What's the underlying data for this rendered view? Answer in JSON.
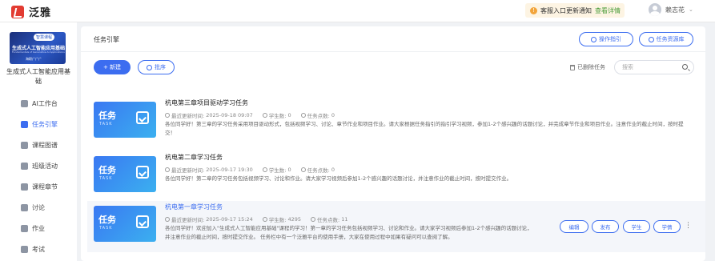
{
  "header": {
    "brand": "泛雅",
    "notice_text": "客服入口更新通知",
    "notice_link": "查看详情",
    "notice_icon": "info-icon",
    "user_name": "赖志花"
  },
  "sidebar": {
    "cover": {
      "badge": "智慧课程",
      "title": "生成式人工智能应用基础",
      "subtitle": "Fundamentals of Generative AI Applications",
      "foot": "海职广广广"
    },
    "course_name": "生成式人工智能应用基础",
    "items": [
      {
        "label": "AI工作台",
        "icon": "ai-icon"
      },
      {
        "label": "任务引擎",
        "icon": "task-icon",
        "active": true
      },
      {
        "label": "课程图谱",
        "icon": "graph-icon"
      },
      {
        "label": "班级活动",
        "icon": "activity-icon"
      },
      {
        "label": "课程章节",
        "icon": "chapter-icon"
      },
      {
        "label": "讨论",
        "icon": "discussion-icon"
      },
      {
        "label": "作业",
        "icon": "homework-icon"
      },
      {
        "label": "考试",
        "icon": "exam-icon"
      }
    ]
  },
  "main": {
    "title": "任务引擎",
    "guide_button": "操作指引",
    "library_button": "任务资源库",
    "new_button": "+ 新建",
    "batch_button": "批序",
    "deleted_label": "已删除任务",
    "search_placeholder": "搜索",
    "meta_labels": {
      "updated": "最近更新时间:",
      "students": "学生数:",
      "points": "任务点数:"
    },
    "tasks": [
      {
        "thumb_title": "任务",
        "thumb_sub": "TASK",
        "title": "杭电第三章项目驱动学习任务",
        "updated": "2025-09-18 09:07",
        "students": "0",
        "points": "0",
        "desc": "各位同学好！第三章的学习任务采用项目驱动形式，包括视频学习、讨论、章节作业和项目作业。请大家根据任务指引的指引学习视频，参加1-2个感兴趣的话题讨论，并完成章节作业和项目作业。注意作业的截止时间，按时提交！"
      },
      {
        "thumb_title": "任务",
        "thumb_sub": "TASK",
        "title": "杭电第二章学习任务",
        "updated": "2025-09-17 19:30",
        "students": "0",
        "points": "0",
        "desc": "各位同学好！第二章的学习任务包括视频学习、讨论和作业。请大家学习视频后参加1-2个感兴趣的话题讨论，并注意作业的截止时间，按时提交作业。"
      },
      {
        "thumb_title": "任务",
        "thumb_sub": "TASK",
        "title": "杭电第一章学习任务",
        "updated": "2025-09-17 15:24",
        "students": "4295",
        "points": "11",
        "desc": "各位同学好！欢迎加入\"生成式人工智能应用基础\"课程的学习！第一章的学习任务包括视频学习、讨论和作业。请大家学习视频后参加1-2个感兴趣的话题讨论，并注意作业的截止时间，按时提交作业。 任务栏中有一个泛雅平台的使用手册，大家在使用过程中如果有疑问可以查阅了解。",
        "actions": [
          "编辑",
          "发布",
          "学生",
          "学情"
        ]
      }
    ]
  }
}
